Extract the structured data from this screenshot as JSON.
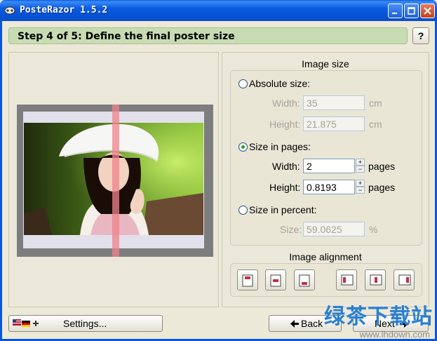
{
  "window": {
    "title": "PosteRazor 1.5.2"
  },
  "step": {
    "title": "Step 4 of 5: Define the final poster size",
    "help_label": "?"
  },
  "image_size": {
    "group_title": "Image size",
    "absolute": {
      "label": "Absolute size:",
      "selected": false,
      "width_label": "Width:",
      "width_value": "35",
      "width_unit": "cm",
      "height_label": "Height:",
      "height_value": "21.875",
      "height_unit": "cm"
    },
    "pages": {
      "label": "Size in pages:",
      "selected": true,
      "width_label": "Width:",
      "width_value": "2",
      "width_unit": "pages",
      "height_label": "Height:",
      "height_value": "0.8193",
      "height_unit": "pages"
    },
    "percent": {
      "label": "Size in percent:",
      "selected": false,
      "size_label": "Size:",
      "size_value": "59.0625",
      "size_unit": "%"
    }
  },
  "image_alignment": {
    "group_title": "Image alignment",
    "buttons": [
      "align-top-icon",
      "align-center-icon",
      "align-bottom-icon",
      "align-left-icon",
      "align-middle-icon",
      "align-right-icon"
    ]
  },
  "footer": {
    "settings_label": "Settings...",
    "back_label": "Back",
    "next_label": "Next"
  },
  "watermark": {
    "text": "绿茶下载站",
    "url": "www.lhdown.com"
  },
  "colors": {
    "titlebar": "#0a5be0",
    "step_header": "#c8dcb4",
    "panel": "#ebe8da",
    "cut_line": "#f0828c",
    "radio_dot": "#21a121"
  }
}
